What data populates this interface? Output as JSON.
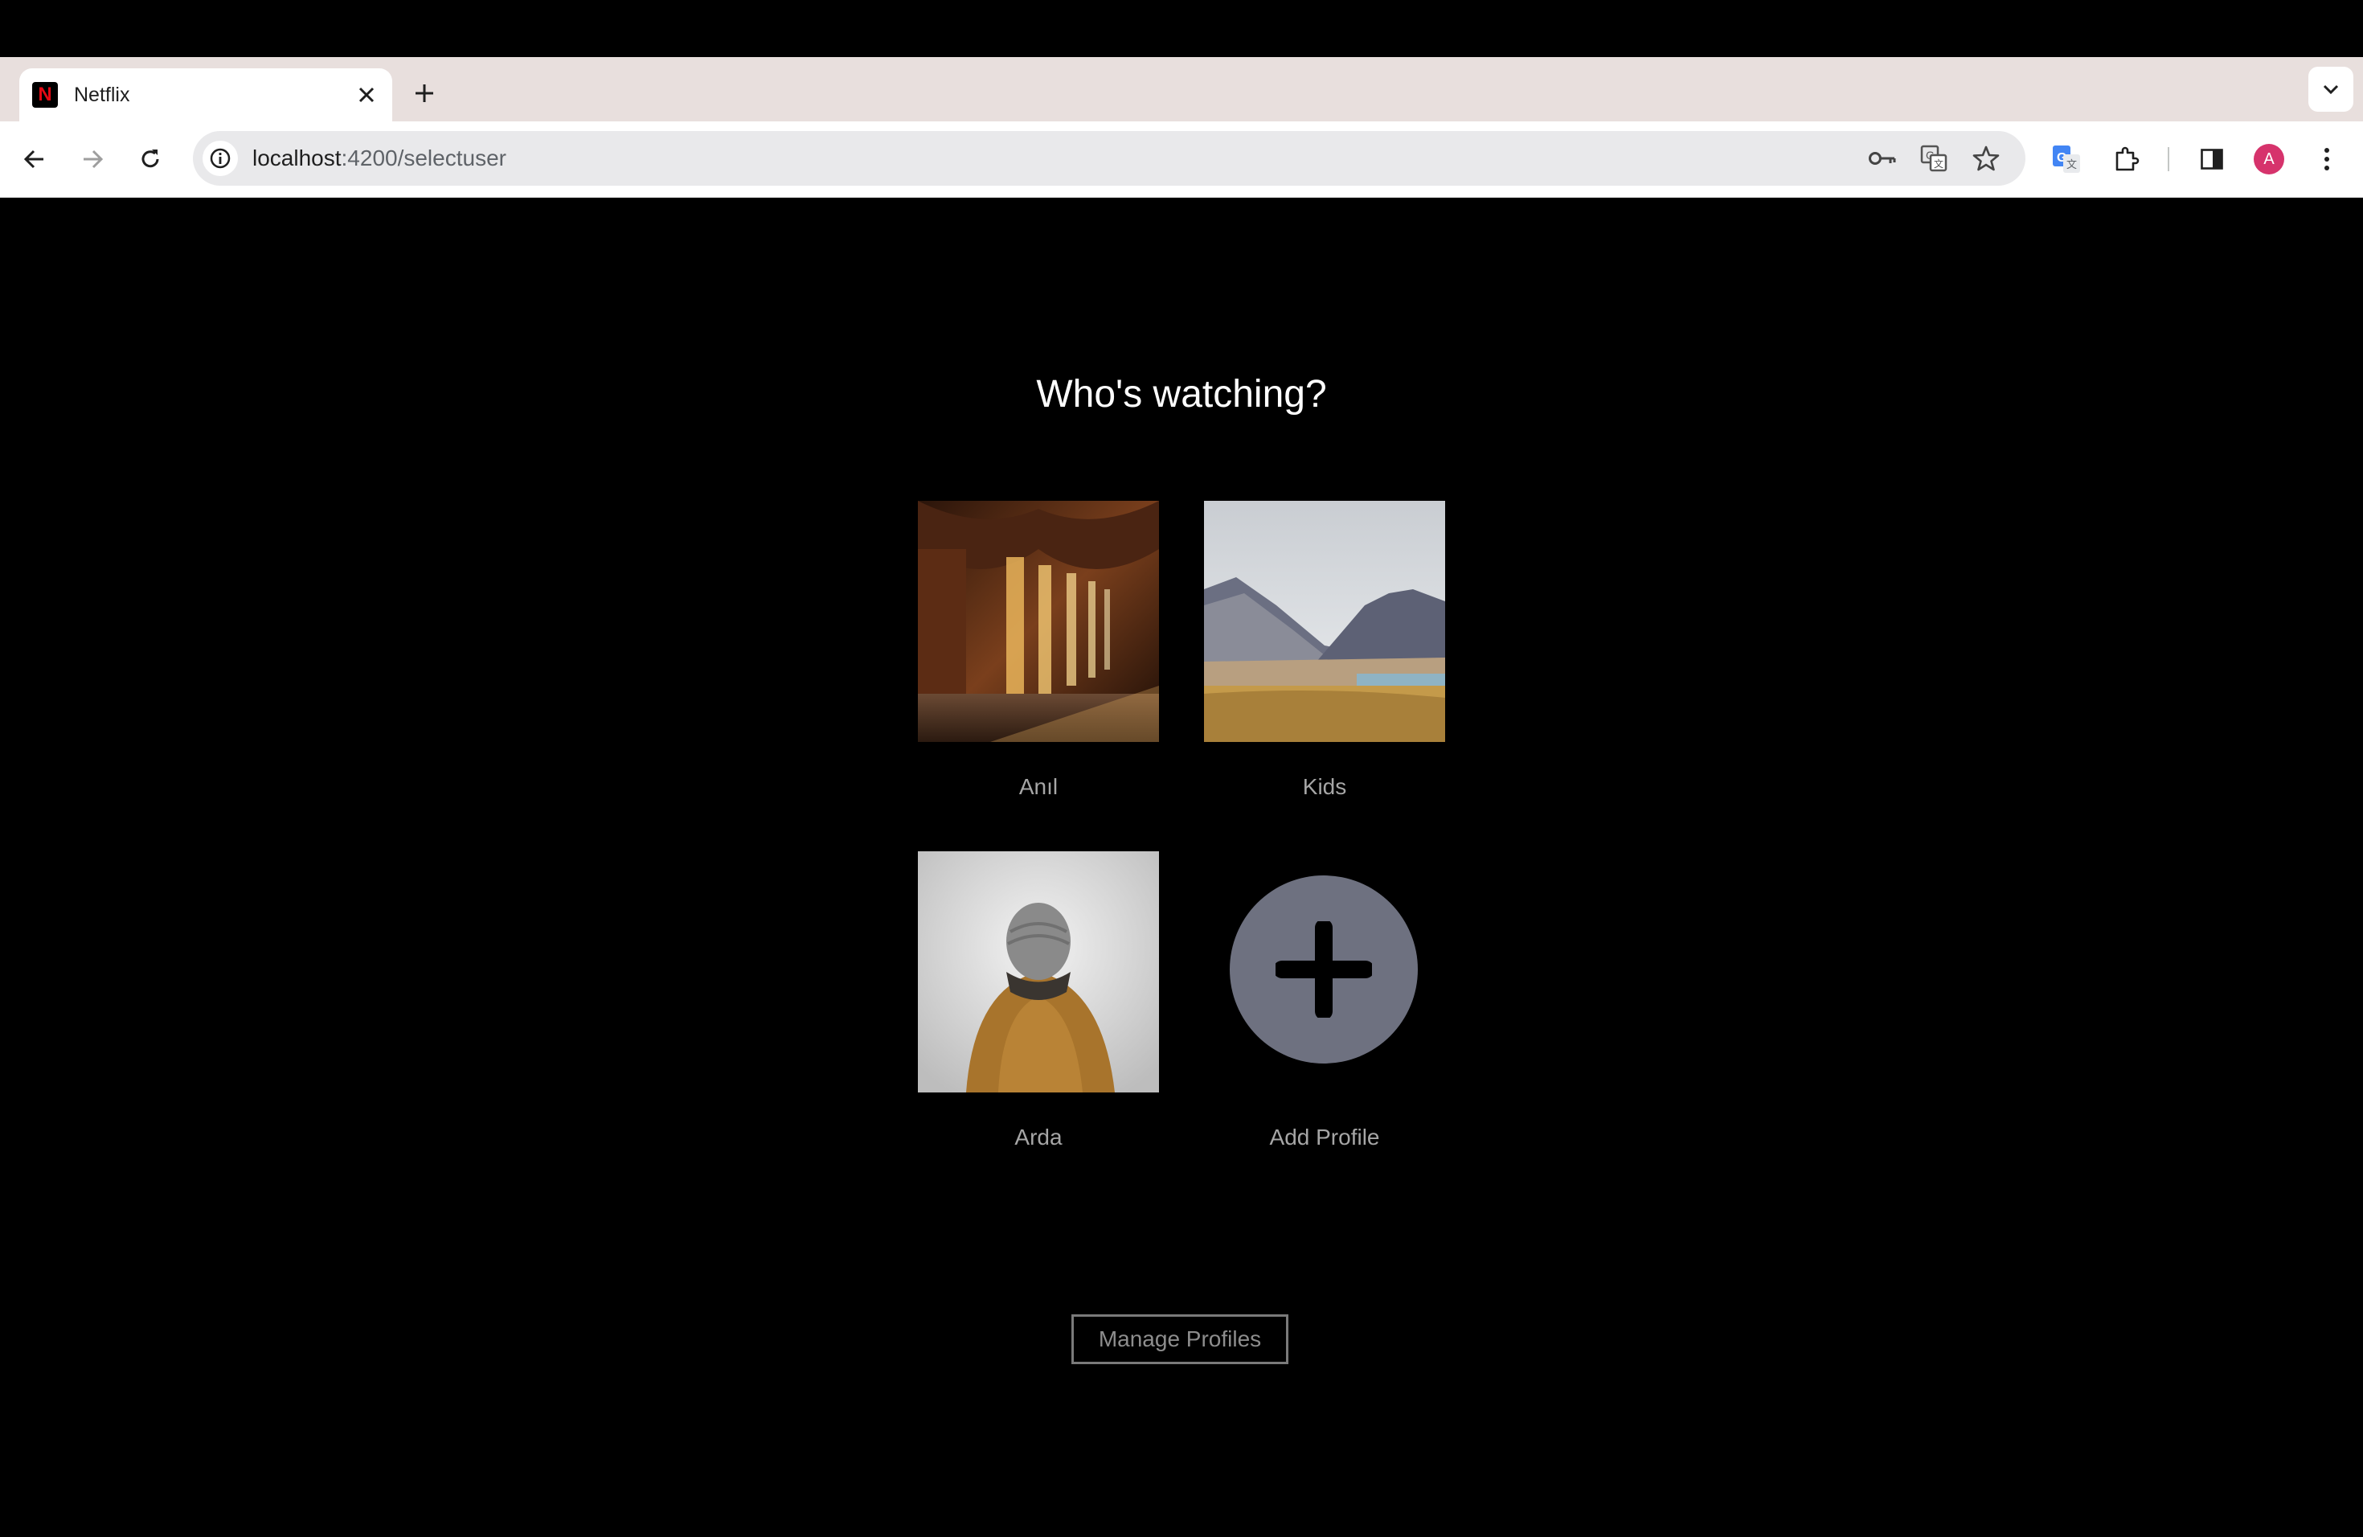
{
  "browser": {
    "tab": {
      "title": "Netflix",
      "favicon_letter": "N",
      "favicon_color": "#e50914"
    },
    "url": {
      "host": "localhost",
      "path": ":4200/selectuser"
    },
    "account_initial": "A",
    "icons": [
      "back-icon",
      "forward-icon",
      "reload-icon",
      "site-info-icon",
      "key-icon",
      "translate-icon",
      "star-icon",
      "google-translate-icon",
      "extensions-icon",
      "side-panel-icon",
      "menu-icon"
    ]
  },
  "page": {
    "heading": "Who's watching?",
    "profiles": [
      {
        "name": "Anıl",
        "image": "cloister-arches"
      },
      {
        "name": "Kids",
        "image": "mountain-lake"
      },
      {
        "name": "Arda",
        "image": "person-in-beanie"
      }
    ],
    "add_profile_label": "Add Profile",
    "manage_profiles_label": "Manage Profiles"
  }
}
